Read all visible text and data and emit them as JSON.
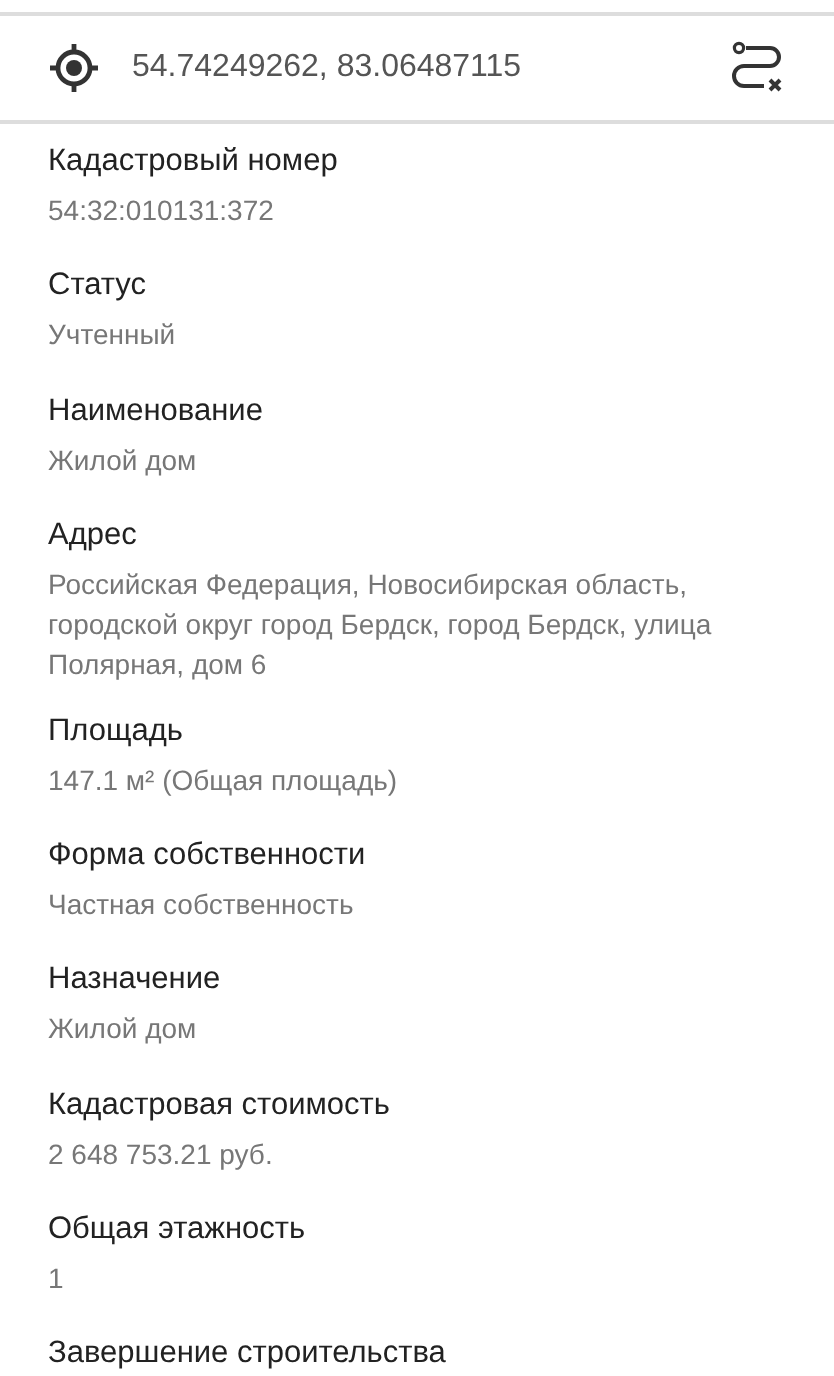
{
  "location_bar": {
    "coordinates": "54.74249262, 83.06487115"
  },
  "fields": [
    {
      "label": "Кадастровый номер",
      "value": "54:32:010131:372"
    },
    {
      "label": "Статус",
      "value": "Учтенный"
    },
    {
      "label": "Наименование",
      "value": "Жилой дом"
    },
    {
      "label": "Адрес",
      "value": "Российская Федерация, Новосибирская область, городской округ город Бердск, город Бердск, улица Полярная, дом 6"
    },
    {
      "label": "Площадь",
      "value": "147.1 м² (Общая площадь)"
    },
    {
      "label": "Форма собственности",
      "value": "Частная собственность"
    },
    {
      "label": "Назначение",
      "value": "Жилой дом"
    },
    {
      "label": "Кадастровая стоимость",
      "value": "2 648 753.21 руб."
    },
    {
      "label": "Общая этажность",
      "value": "1"
    },
    {
      "label": "Завершение строительства"
    }
  ]
}
